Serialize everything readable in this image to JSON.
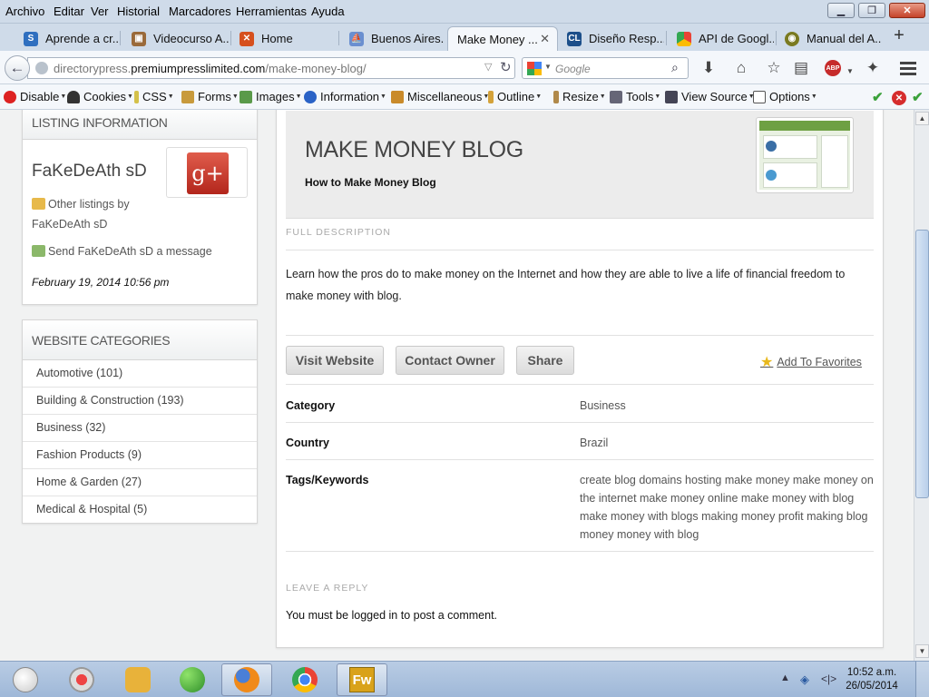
{
  "menubar": {
    "items": [
      "Archivo",
      "Editar",
      "Ver",
      "Historial",
      "Marcadores",
      "Herramientas",
      "Ayuda"
    ]
  },
  "tabs": [
    {
      "label": "Aprende a cr...",
      "icon": "shield-s-icon",
      "color": "#2f6fbf",
      "active": false
    },
    {
      "label": "Videocurso A...",
      "icon": "box-icon",
      "color": "#9a6a3a",
      "active": false
    },
    {
      "label": "Home",
      "icon": "x-logo-icon",
      "color": "#d6501e",
      "active": false
    },
    {
      "label": "Buenos Aires...",
      "icon": "sail-icon",
      "color": "#6a8fd0",
      "active": false
    },
    {
      "label": "Make Money ...",
      "icon": "page-icon",
      "color": "#ffffff",
      "active": true
    },
    {
      "label": "Diseño Resp...",
      "icon": "cl-icon",
      "color": "#1c4f8a",
      "active": false
    },
    {
      "label": "API de Googl...",
      "icon": "google-api-icon",
      "color": "#34a853",
      "active": false
    },
    {
      "label": "Manual del A...",
      "icon": "manual-icon",
      "color": "#7a7a20",
      "active": false
    }
  ],
  "navbar": {
    "url_prefix": "directorypress.",
    "url_domain": "premiumpresslimited.com",
    "url_path": "/make-money-blog/",
    "search_placeholder": "Google"
  },
  "devbar": {
    "items": [
      "Disable",
      "Cookies",
      "CSS",
      "Forms",
      "Images",
      "Information",
      "Miscellaneous",
      "Outline",
      "Resize",
      "Tools",
      "View Source",
      "Options"
    ]
  },
  "sidebar": {
    "listing_heading": "LISTING INFORMATION",
    "owner": "FaKeDeAth sD",
    "other_listings_line1": "Other listings by",
    "other_listings_line2": "FaKeDeAth sD",
    "send_message": "Send FaKeDeAth sD a message",
    "date": "February 19, 2014 10:56 pm",
    "categories_heading": "WEBSITE CATEGORIES",
    "categories": [
      "Automotive (101)",
      "Building & Construction (193)",
      "Business (32)",
      "Fashion Products (9)",
      "Home & Garden (27)",
      "Medical & Hospital (5)"
    ]
  },
  "main": {
    "title": "MAKE MONEY BLOG",
    "subtitle": "How to Make Money Blog",
    "full_description_label": "FULL DESCRIPTION",
    "description": "Learn how the pros do to make money on the Internet and how they are able to live a life of financial freedom to make money with blog.",
    "buttons": [
      "Visit Website",
      "Contact Owner",
      "Share"
    ],
    "add_to_favorites": "Add To Favorites",
    "details": [
      {
        "key": "Category",
        "value": "Business"
      },
      {
        "key": "Country",
        "value": "Brazil"
      },
      {
        "key": "Tags/Keywords",
        "value": "create blog domains hosting make money make money on the internet make money online make money with blog make money with blogs making money profit making blog money money with blog"
      }
    ],
    "leave_reply_label": "LEAVE A REPLY",
    "reply_text": "You must be logged in to post a comment."
  },
  "taskbar": {
    "clock_time": "10:52 a.m.",
    "clock_date": "26/05/2014"
  },
  "colors": {
    "accent_star": "#e8b81b",
    "gplus_red": "#c5362a",
    "chrome_blue": "#cfdbe9"
  }
}
